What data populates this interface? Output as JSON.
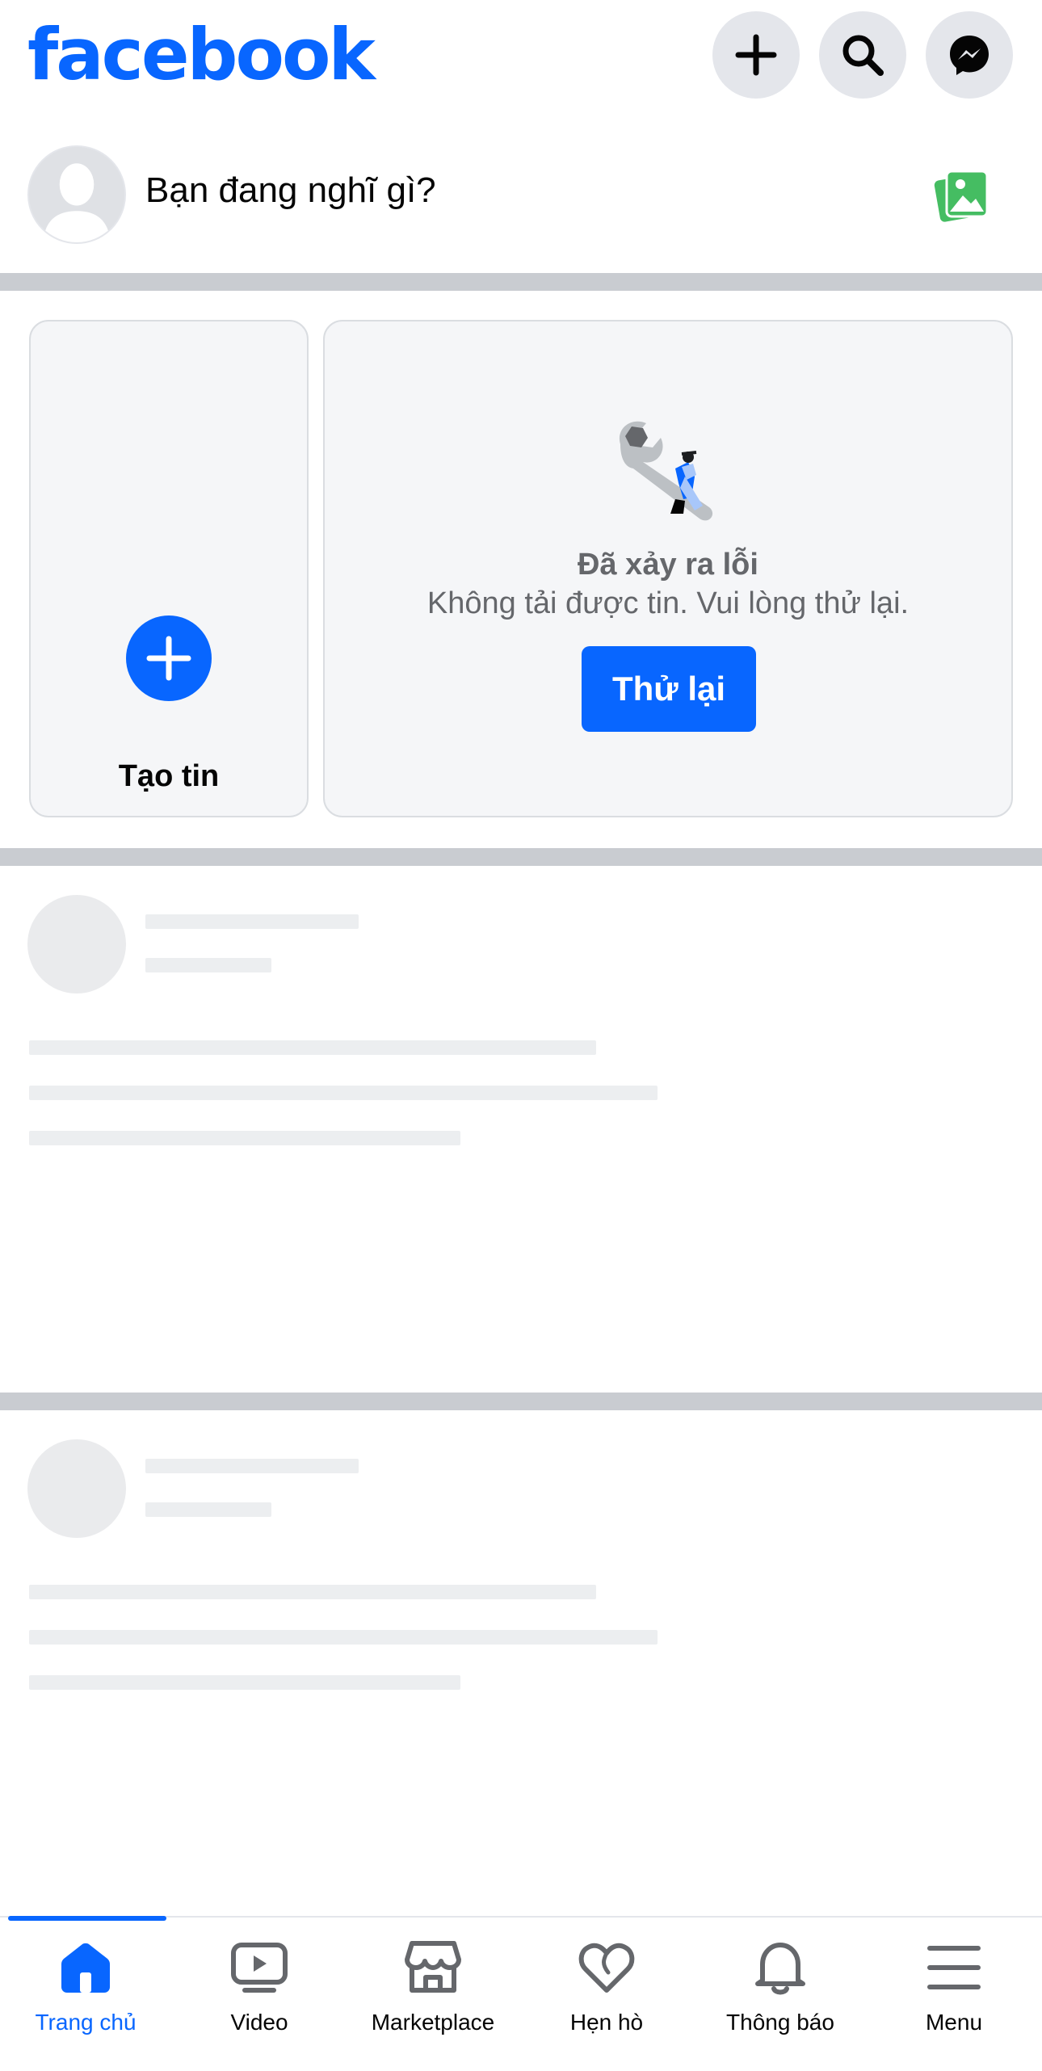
{
  "header": {
    "logo": "facebook",
    "icons": [
      "plus-icon",
      "search-icon",
      "messenger-icon"
    ]
  },
  "composer": {
    "placeholder": "Bạn đang nghĩ gì?",
    "photo_icon": "photo-icon"
  },
  "stories": {
    "create_label": "Tạo tin",
    "error_title": "Đã xảy ra lỗi",
    "error_message": "Không tải được tin. Vui lòng thử lại.",
    "retry_label": "Thử lại"
  },
  "bottom_nav": {
    "items": [
      {
        "label": "Trang chủ",
        "icon": "home-icon",
        "active": true
      },
      {
        "label": "Video",
        "icon": "video-icon",
        "active": false
      },
      {
        "label": "Marketplace",
        "icon": "marketplace-icon",
        "active": false
      },
      {
        "label": "Hẹn hò",
        "icon": "heart-icon",
        "active": false
      },
      {
        "label": "Thông báo",
        "icon": "bell-icon",
        "active": false
      },
      {
        "label": "Menu",
        "icon": "menu-icon",
        "active": false
      }
    ]
  },
  "colors": {
    "brand": "#0866ff",
    "divider": "#c9ccd1",
    "secondary_text": "#65676b",
    "photo_green": "#45bd62"
  }
}
